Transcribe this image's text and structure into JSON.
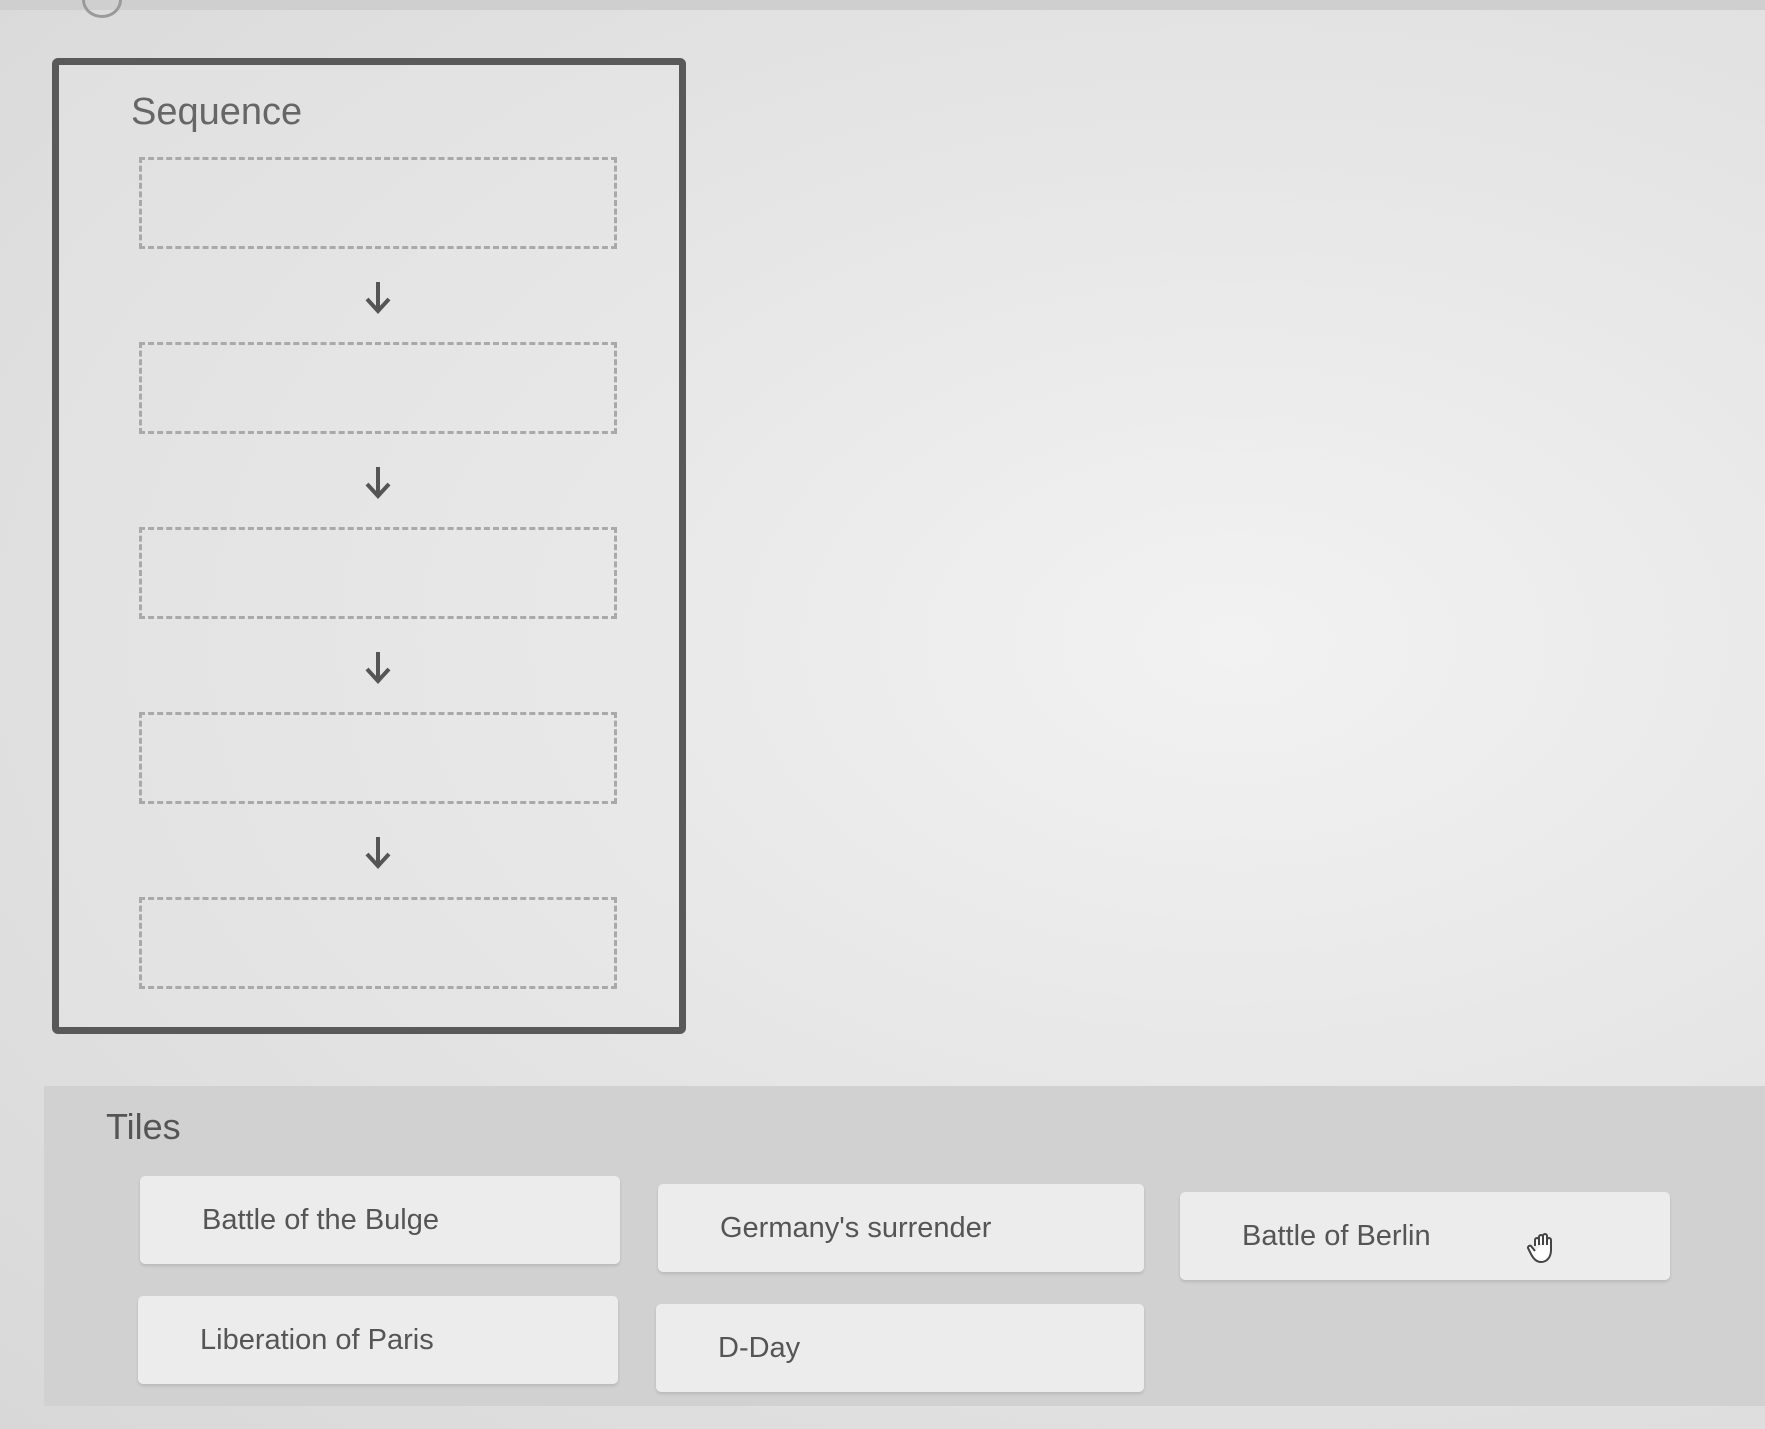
{
  "sequence": {
    "title": "Sequence",
    "slot_count": 5
  },
  "tiles": {
    "title": "Tiles",
    "items": [
      {
        "label": "Battle of the Bulge"
      },
      {
        "label": "Germany's surrender"
      },
      {
        "label": "Battle of Berlin"
      },
      {
        "label": "Liberation of Paris"
      },
      {
        "label": "D-Day"
      }
    ]
  },
  "icons": {
    "arrow": "arrow-down-icon",
    "cursor": "grab-hand-icon"
  },
  "colors": {
    "panel_border": "#595959",
    "slot_border": "#a9a9a9",
    "tile_bg": "#ececec",
    "tiles_panel_bg": "#d1d1d1"
  }
}
